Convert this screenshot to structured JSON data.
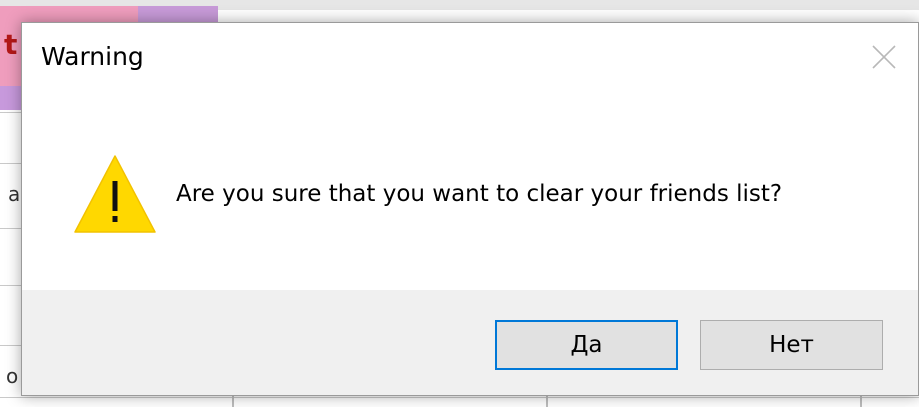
{
  "dialog": {
    "title": "Warning",
    "message": "Are you sure that you want to clear your friends list?",
    "icon": "warning-icon",
    "buttons": {
      "yes_label": "Да",
      "no_label": "Нет"
    }
  },
  "colors": {
    "accent_border": "#0078d7",
    "warning_yellow": "#ffd800",
    "footer_bg": "#f0f0f0",
    "button_bg": "#e1e1e1"
  },
  "background": {
    "fragments": [
      "t",
      "a",
      "o"
    ]
  }
}
